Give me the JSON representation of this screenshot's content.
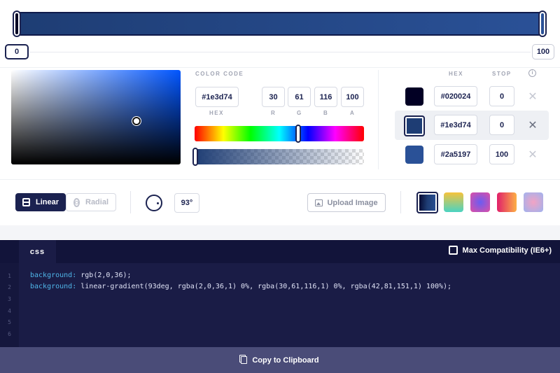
{
  "gradient": {
    "preview_css": "linear-gradient(93deg, rgba(2,0,36,1) 0%, rgba(30,61,116,1) 0%, rgba(42,81,151,1) 100%)",
    "left_pos": "0",
    "right_pos": "100"
  },
  "picker": {
    "color_code_label": "COLOR CODE",
    "hex": "#1e3d74",
    "r": "30",
    "g": "61",
    "b": "116",
    "a": "100",
    "hex_label": "HEX",
    "r_label": "R",
    "g_label": "G",
    "b_label": "B",
    "a_label": "A"
  },
  "stops": {
    "hex_header": "HEX",
    "stop_header": "STOP",
    "info_icon": "info-icon",
    "items": [
      {
        "color": "#020024",
        "hex": "#020024",
        "stop": "0",
        "selected": false
      },
      {
        "color": "#1e3d74",
        "hex": "#1e3d74",
        "stop": "0",
        "selected": true
      },
      {
        "color": "#2a5197",
        "hex": "#2a5197",
        "stop": "100",
        "selected": false
      }
    ],
    "remove_glyph": "✕"
  },
  "toolbar": {
    "linear_label": "Linear",
    "radial_label": "Radial",
    "angle": "93°",
    "upload_label": "Upload Image",
    "presets": [
      "linear-gradient(93deg,#020024,#1e3d74,#2a5197)",
      "linear-gradient(180deg,#f6c33b,#4ad3c2)",
      "radial-gradient(circle,#6a5cf2,#e04fa4)",
      "linear-gradient(90deg,#e11f6a,#fcb045)",
      "radial-gradient(circle,#f2a3c4,#9fb3ef)"
    ]
  },
  "code": {
    "tab": "css",
    "compat_label": "Max Compatibility (IE6+)",
    "line_numbers": [
      "1",
      "2",
      "3",
      "4",
      "5",
      "6"
    ],
    "line1_prop": "background:",
    "line1_val": " rgb(2,0,36);",
    "line2_prop": "background:",
    "line2_val": " linear-gradient(93deg, rgba(2,0,36,1) 0%, rgba(30,61,116,1) 0%, rgba(42,81,151,1) 100%);",
    "copy_label": "Copy to Clipboard"
  },
  "colors": {
    "accent": "#1b2250",
    "code_bg": "#1a1c46",
    "keyword": "#4fb5e8"
  }
}
